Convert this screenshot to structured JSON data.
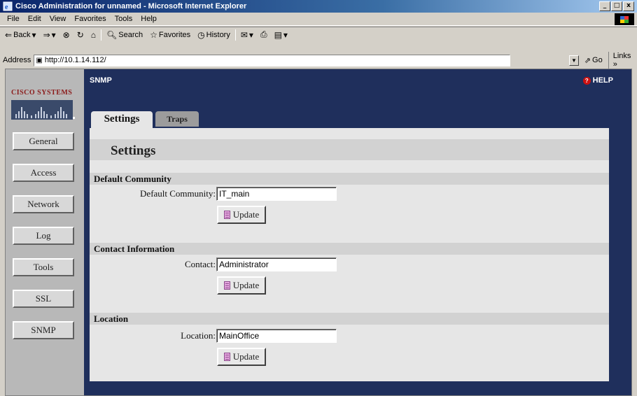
{
  "window": {
    "title": "Cisco Administration for unnamed - Microsoft Internet Explorer",
    "controls": [
      "_",
      "□",
      "x"
    ]
  },
  "menubar": {
    "items": [
      "File",
      "Edit",
      "View",
      "Favorites",
      "Tools",
      "Help"
    ]
  },
  "toolbar": {
    "back_label": "Back",
    "search_label": "Search",
    "favorites_label": "Favorites",
    "history_label": "History"
  },
  "addressbar": {
    "label": "Address",
    "url": "http://10.1.14.112/",
    "go_label": "Go",
    "links_label": "Links »"
  },
  "brand": {
    "logo_text": "Cisco Systems",
    "logo_color": "#8b1a1a"
  },
  "sidebar": {
    "items": [
      {
        "label": "General"
      },
      {
        "label": "Access"
      },
      {
        "label": "Network"
      },
      {
        "label": "Log"
      },
      {
        "label": "Tools"
      },
      {
        "label": "SSL"
      },
      {
        "label": "SNMP"
      }
    ]
  },
  "header": {
    "section": "SNMP",
    "help_label": "HELP"
  },
  "tabs": [
    {
      "label": "Settings",
      "active": true
    },
    {
      "label": "Traps",
      "active": false
    }
  ],
  "panel": {
    "title": "Settings",
    "sections": [
      {
        "heading": "Default Community",
        "field_label": "Default Community:",
        "value": "IT_main",
        "button": "Update"
      },
      {
        "heading": "Contact Information",
        "field_label": "Contact:",
        "value": "Administrator",
        "button": "Update"
      },
      {
        "heading": "Location",
        "field_label": "Location:",
        "value": "MainOffice",
        "button": "Update"
      }
    ]
  },
  "colors": {
    "page_background": "#1f2f5c",
    "sidebar_background": "#b8b8b8",
    "panel_background": "#e6e6e6"
  }
}
